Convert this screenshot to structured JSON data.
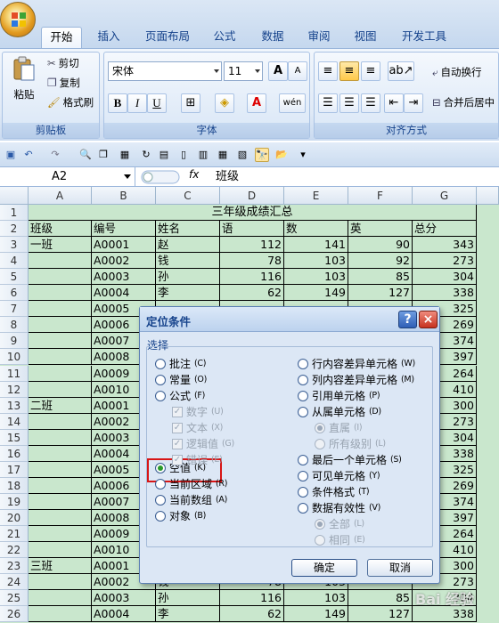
{
  "ribbon": {
    "tabs": [
      "开始",
      "插入",
      "页面布局",
      "公式",
      "数据",
      "审阅",
      "视图",
      "开发工具"
    ],
    "clipboard": {
      "paste": "粘贴",
      "cut": "剪切",
      "copy": "复制",
      "format_painter": "格式刷",
      "label": "剪贴板"
    },
    "font": {
      "name": "宋体",
      "size": "11",
      "bold": "B",
      "italic": "I",
      "underline": "U",
      "label": "字体",
      "grow": "A",
      "shrink": "A",
      "phonetic": "wén"
    },
    "alignment": {
      "wrap": "自动换行",
      "merge": "合并后居中",
      "label": "对齐方式"
    }
  },
  "formula_bar": {
    "name_box": "A2",
    "fx": "fx",
    "value": "班级"
  },
  "columns": [
    "A",
    "B",
    "C",
    "D",
    "E",
    "F",
    "G"
  ],
  "rows": [
    {
      "n": "1",
      "cells": [
        "三年级成绩汇总"
      ]
    },
    {
      "n": "2",
      "cells": [
        "班级",
        "编号",
        "姓名",
        "语",
        "数",
        "英",
        "总分"
      ]
    },
    {
      "n": "3",
      "cells": [
        "一班",
        "A0001",
        "赵",
        "112",
        "141",
        "90",
        "343"
      ]
    },
    {
      "n": "4",
      "cells": [
        "",
        "A0002",
        "钱",
        "78",
        "103",
        "92",
        "273"
      ]
    },
    {
      "n": "5",
      "cells": [
        "",
        "A0003",
        "孙",
        "116",
        "103",
        "85",
        "304"
      ]
    },
    {
      "n": "6",
      "cells": [
        "",
        "A0004",
        "李",
        "62",
        "149",
        "127",
        "338"
      ]
    },
    {
      "n": "7",
      "cells": [
        "",
        "A0005",
        "",
        "",
        "",
        "",
        "325"
      ]
    },
    {
      "n": "8",
      "cells": [
        "",
        "A0006",
        "",
        "",
        "",
        "",
        "269"
      ]
    },
    {
      "n": "9",
      "cells": [
        "",
        "A0007",
        "",
        "",
        "",
        "",
        "374"
      ]
    },
    {
      "n": "10",
      "cells": [
        "",
        "A0008",
        "",
        "",
        "",
        "",
        "397"
      ]
    },
    {
      "n": "11",
      "cells": [
        "",
        "A0009",
        "",
        "",
        "",
        "",
        "264"
      ]
    },
    {
      "n": "12",
      "cells": [
        "",
        "A0010",
        "",
        "",
        "",
        "",
        "410"
      ]
    },
    {
      "n": "13",
      "cells": [
        "二班",
        "A0001",
        "",
        "",
        "",
        "",
        "300"
      ]
    },
    {
      "n": "14",
      "cells": [
        "",
        "A0002",
        "",
        "",
        "",
        "",
        "273"
      ]
    },
    {
      "n": "15",
      "cells": [
        "",
        "A0003",
        "",
        "",
        "",
        "",
        "304"
      ]
    },
    {
      "n": "16",
      "cells": [
        "",
        "A0004",
        "",
        "",
        "",
        "",
        "338"
      ]
    },
    {
      "n": "17",
      "cells": [
        "",
        "A0005",
        "",
        "",
        "",
        "",
        "325"
      ]
    },
    {
      "n": "18",
      "cells": [
        "",
        "A0006",
        "",
        "",
        "",
        "",
        "269"
      ]
    },
    {
      "n": "19",
      "cells": [
        "",
        "A0007",
        "",
        "",
        "",
        "",
        "374"
      ]
    },
    {
      "n": "20",
      "cells": [
        "",
        "A0008",
        "",
        "",
        "",
        "",
        "397"
      ]
    },
    {
      "n": "21",
      "cells": [
        "",
        "A0009",
        "",
        "",
        "",
        "",
        "264"
      ]
    },
    {
      "n": "22",
      "cells": [
        "",
        "A0010",
        "",
        "",
        "",
        "",
        "410"
      ]
    },
    {
      "n": "23",
      "cells": [
        "三班",
        "A0001",
        "",
        "",
        "",
        "",
        "300"
      ]
    },
    {
      "n": "24",
      "cells": [
        "",
        "A0002",
        "钱",
        "78",
        "103",
        "",
        "273"
      ]
    },
    {
      "n": "25",
      "cells": [
        "",
        "A0003",
        "孙",
        "116",
        "103",
        "85",
        "304"
      ]
    },
    {
      "n": "26",
      "cells": [
        "",
        "A0004",
        "李",
        "62",
        "149",
        "127",
        "338"
      ]
    }
  ],
  "dialog": {
    "title": "定位条件",
    "help": "?",
    "close": "×",
    "group_label": "选择",
    "left_options": [
      {
        "label": "批注",
        "key": "(C)"
      },
      {
        "label": "常量",
        "key": "(O)"
      },
      {
        "label": "公式",
        "key": "(F)"
      },
      {
        "label": "空值",
        "key": "(K)"
      },
      {
        "label": "当前区域",
        "key": "(R)"
      },
      {
        "label": "当前数组",
        "key": "(A)"
      },
      {
        "label": "对象",
        "key": "(B)"
      }
    ],
    "sub_options": [
      {
        "label": "数字",
        "key": "(U)"
      },
      {
        "label": "文本",
        "key": "(X)"
      },
      {
        "label": "逻辑值",
        "key": "(G)"
      },
      {
        "label": "错误",
        "key": "(E)"
      }
    ],
    "right_options": [
      {
        "label": "行内容差异单元格",
        "key": "(W)"
      },
      {
        "label": "列内容差异单元格",
        "key": "(M)"
      },
      {
        "label": "引用单元格",
        "key": "(P)"
      },
      {
        "label": "从属单元格",
        "key": "(D)"
      },
      {
        "label": "最后一个单元格",
        "key": "(S)"
      },
      {
        "label": "可见单元格",
        "key": "(Y)"
      },
      {
        "label": "条件格式",
        "key": "(T)"
      },
      {
        "label": "数据有效性",
        "key": "(V)"
      }
    ],
    "dep_sub": [
      {
        "label": "直属",
        "key": "(I)"
      },
      {
        "label": "所有级别",
        "key": "(L)"
      }
    ],
    "valid_sub": [
      {
        "label": "全部",
        "key": "(L)"
      },
      {
        "label": "相同",
        "key": "(E)"
      }
    ],
    "ok": "确定",
    "cancel": "取消"
  },
  "watermark": "Bai 经验"
}
